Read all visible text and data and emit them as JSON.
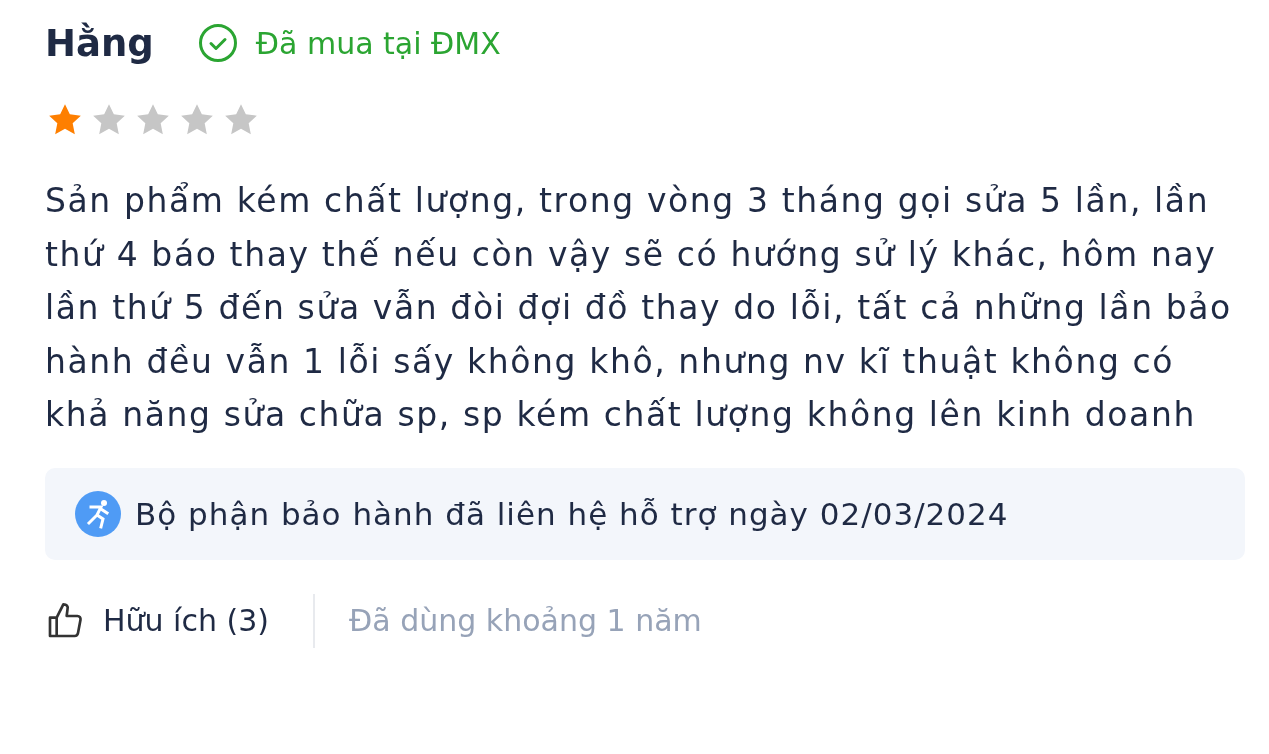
{
  "review": {
    "author": "Hằng",
    "purchase_badge": "Đã mua tại ĐMX",
    "stars": 1,
    "text": "Sản phẩm kém chất lượng, trong vòng 3 tháng gọi sửa 5 lần, lần thứ 4 báo thay thế nếu còn vậy sẽ có hướng sử lý khác, hôm nay lần thứ 5 đến sửa vẫn đòi đợi đồ thay do lỗi, tất cả những lần bảo hành đều vẫn 1 lỗi sấy không khô, nhưng nv kĩ thuật không có khả năng sửa chữa sp, sp kém chất lượng không lên kinh doanh",
    "support_note": "Bộ phận bảo hành đã liên hệ hỗ trợ ngày 02/03/2024",
    "helpful": "Hữu ích (3)",
    "usage": "Đã dùng khoảng 1 năm"
  }
}
